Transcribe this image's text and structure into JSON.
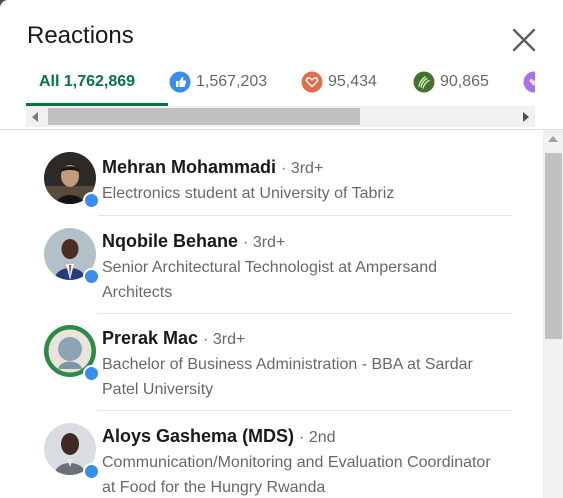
{
  "modal": {
    "title": "Reactions"
  },
  "tabs": [
    {
      "label": "All 1,762,869",
      "icon": "none",
      "active": true
    },
    {
      "label": "1,567,203",
      "icon": "like-icon",
      "color": "#378fe9"
    },
    {
      "label": "95,434",
      "icon": "love-icon",
      "color": "#df704d"
    },
    {
      "label": "90,865",
      "icon": "celebrate-icon",
      "color": "#44712e"
    }
  ],
  "people": [
    {
      "name": "Mehran Mohammadi",
      "degree": "· 3rd+",
      "headline": "Electronics student at University of Tabriz"
    },
    {
      "name": "Nqobile Behane",
      "degree": "· 3rd+",
      "headline": "Senior Architectural Technologist at Ampersand Architects"
    },
    {
      "name": "Prerak Mac",
      "degree": "· 3rd+",
      "headline": "Bachelor of Business Administration - BBA at Sardar Patel University"
    },
    {
      "name": "Aloys Gashema (MDS)",
      "degree": "· 2nd",
      "headline": "Communication/Monitoring and Evaluation Coordinator at Food for the Hungry Rwanda"
    }
  ],
  "colors": {
    "accent": "#057642",
    "like": "#378fe9",
    "love": "#df704d",
    "celebrate": "#44712e"
  }
}
